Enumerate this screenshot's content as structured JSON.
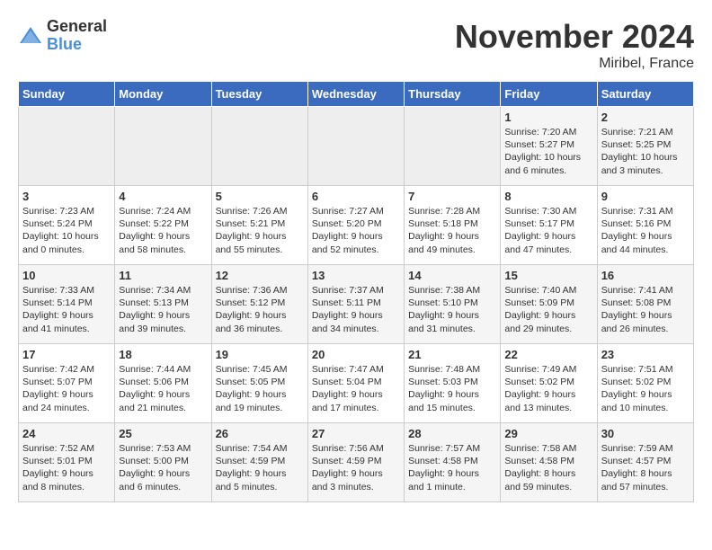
{
  "logo": {
    "general": "General",
    "blue": "Blue"
  },
  "header": {
    "month": "November 2024",
    "location": "Miribel, France"
  },
  "weekdays": [
    "Sunday",
    "Monday",
    "Tuesday",
    "Wednesday",
    "Thursday",
    "Friday",
    "Saturday"
  ],
  "weeks": [
    [
      {
        "day": "",
        "info": ""
      },
      {
        "day": "",
        "info": ""
      },
      {
        "day": "",
        "info": ""
      },
      {
        "day": "",
        "info": ""
      },
      {
        "day": "",
        "info": ""
      },
      {
        "day": "1",
        "info": "Sunrise: 7:20 AM\nSunset: 5:27 PM\nDaylight: 10 hours and 6 minutes."
      },
      {
        "day": "2",
        "info": "Sunrise: 7:21 AM\nSunset: 5:25 PM\nDaylight: 10 hours and 3 minutes."
      }
    ],
    [
      {
        "day": "3",
        "info": "Sunrise: 7:23 AM\nSunset: 5:24 PM\nDaylight: 10 hours and 0 minutes."
      },
      {
        "day": "4",
        "info": "Sunrise: 7:24 AM\nSunset: 5:22 PM\nDaylight: 9 hours and 58 minutes."
      },
      {
        "day": "5",
        "info": "Sunrise: 7:26 AM\nSunset: 5:21 PM\nDaylight: 9 hours and 55 minutes."
      },
      {
        "day": "6",
        "info": "Sunrise: 7:27 AM\nSunset: 5:20 PM\nDaylight: 9 hours and 52 minutes."
      },
      {
        "day": "7",
        "info": "Sunrise: 7:28 AM\nSunset: 5:18 PM\nDaylight: 9 hours and 49 minutes."
      },
      {
        "day": "8",
        "info": "Sunrise: 7:30 AM\nSunset: 5:17 PM\nDaylight: 9 hours and 47 minutes."
      },
      {
        "day": "9",
        "info": "Sunrise: 7:31 AM\nSunset: 5:16 PM\nDaylight: 9 hours and 44 minutes."
      }
    ],
    [
      {
        "day": "10",
        "info": "Sunrise: 7:33 AM\nSunset: 5:14 PM\nDaylight: 9 hours and 41 minutes."
      },
      {
        "day": "11",
        "info": "Sunrise: 7:34 AM\nSunset: 5:13 PM\nDaylight: 9 hours and 39 minutes."
      },
      {
        "day": "12",
        "info": "Sunrise: 7:36 AM\nSunset: 5:12 PM\nDaylight: 9 hours and 36 minutes."
      },
      {
        "day": "13",
        "info": "Sunrise: 7:37 AM\nSunset: 5:11 PM\nDaylight: 9 hours and 34 minutes."
      },
      {
        "day": "14",
        "info": "Sunrise: 7:38 AM\nSunset: 5:10 PM\nDaylight: 9 hours and 31 minutes."
      },
      {
        "day": "15",
        "info": "Sunrise: 7:40 AM\nSunset: 5:09 PM\nDaylight: 9 hours and 29 minutes."
      },
      {
        "day": "16",
        "info": "Sunrise: 7:41 AM\nSunset: 5:08 PM\nDaylight: 9 hours and 26 minutes."
      }
    ],
    [
      {
        "day": "17",
        "info": "Sunrise: 7:42 AM\nSunset: 5:07 PM\nDaylight: 9 hours and 24 minutes."
      },
      {
        "day": "18",
        "info": "Sunrise: 7:44 AM\nSunset: 5:06 PM\nDaylight: 9 hours and 21 minutes."
      },
      {
        "day": "19",
        "info": "Sunrise: 7:45 AM\nSunset: 5:05 PM\nDaylight: 9 hours and 19 minutes."
      },
      {
        "day": "20",
        "info": "Sunrise: 7:47 AM\nSunset: 5:04 PM\nDaylight: 9 hours and 17 minutes."
      },
      {
        "day": "21",
        "info": "Sunrise: 7:48 AM\nSunset: 5:03 PM\nDaylight: 9 hours and 15 minutes."
      },
      {
        "day": "22",
        "info": "Sunrise: 7:49 AM\nSunset: 5:02 PM\nDaylight: 9 hours and 13 minutes."
      },
      {
        "day": "23",
        "info": "Sunrise: 7:51 AM\nSunset: 5:02 PM\nDaylight: 9 hours and 10 minutes."
      }
    ],
    [
      {
        "day": "24",
        "info": "Sunrise: 7:52 AM\nSunset: 5:01 PM\nDaylight: 9 hours and 8 minutes."
      },
      {
        "day": "25",
        "info": "Sunrise: 7:53 AM\nSunset: 5:00 PM\nDaylight: 9 hours and 6 minutes."
      },
      {
        "day": "26",
        "info": "Sunrise: 7:54 AM\nSunset: 4:59 PM\nDaylight: 9 hours and 5 minutes."
      },
      {
        "day": "27",
        "info": "Sunrise: 7:56 AM\nSunset: 4:59 PM\nDaylight: 9 hours and 3 minutes."
      },
      {
        "day": "28",
        "info": "Sunrise: 7:57 AM\nSunset: 4:58 PM\nDaylight: 9 hours and 1 minute."
      },
      {
        "day": "29",
        "info": "Sunrise: 7:58 AM\nSunset: 4:58 PM\nDaylight: 8 hours and 59 minutes."
      },
      {
        "day": "30",
        "info": "Sunrise: 7:59 AM\nSunset: 4:57 PM\nDaylight: 8 hours and 57 minutes."
      }
    ]
  ]
}
